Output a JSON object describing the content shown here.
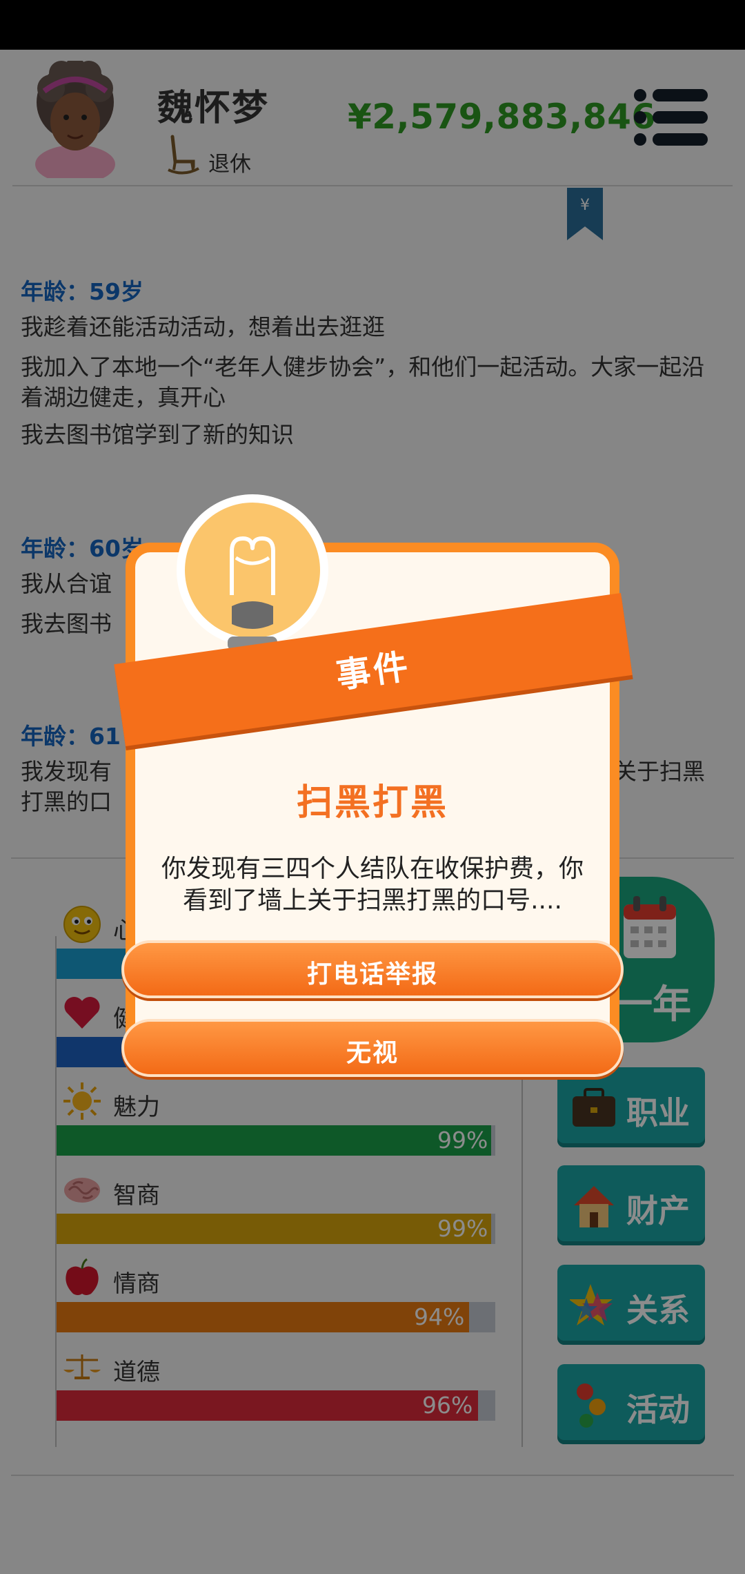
{
  "header": {
    "name": "魏怀梦",
    "status": "退休",
    "money": "¥2,579,883,846"
  },
  "log": [
    {
      "age": "年龄：59岁",
      "lines": [
        "我趁着还能活动活动，想着出去逛逛",
        "我加入了本地一个“老年人健步协会”，和他们一起活动。大家一起沿着湖边健走，真开心",
        "我去图书馆学到了新的知识"
      ]
    },
    {
      "age": "年龄：60岁",
      "lines": [
        "我从合谊",
        "我去图书"
      ]
    },
    {
      "age": "年龄：61",
      "lines": [
        "我发现有",
        "打黑的口",
        "关于扫黑"
      ]
    }
  ],
  "stats": [
    {
      "label": "心",
      "percent": "",
      "color": "#1b9ed2",
      "icon": "smiley-icon"
    },
    {
      "label": "健",
      "percent": "",
      "color": "#1e63c4",
      "icon": "heart-icon"
    },
    {
      "label": "魅力",
      "percent": "99%",
      "value": 0.99,
      "color": "#1aa04a",
      "icon": "sun-icon"
    },
    {
      "label": "智商",
      "percent": "99%",
      "value": 0.99,
      "color": "#d9a70c",
      "icon": "brain-icon"
    },
    {
      "label": "情商",
      "percent": "94%",
      "value": 0.94,
      "color": "#ea7a12",
      "icon": "apple-icon"
    },
    {
      "label": "道德",
      "percent": "96%",
      "value": 0.96,
      "color": "#de2a3b",
      "icon": "scale-icon"
    }
  ],
  "side_buttons": {
    "next_year": "一年",
    "career": "职业",
    "assets": "财产",
    "relations": "关系",
    "activities": "活动"
  },
  "dialog": {
    "ribbon": "事件",
    "title": "扫黑打黑",
    "description": "你发现有三四个人结队在收保护费，你看到了墙上关于扫黑打黑的口号....",
    "button_report": "打电话举报",
    "button_ignore": "无视"
  }
}
